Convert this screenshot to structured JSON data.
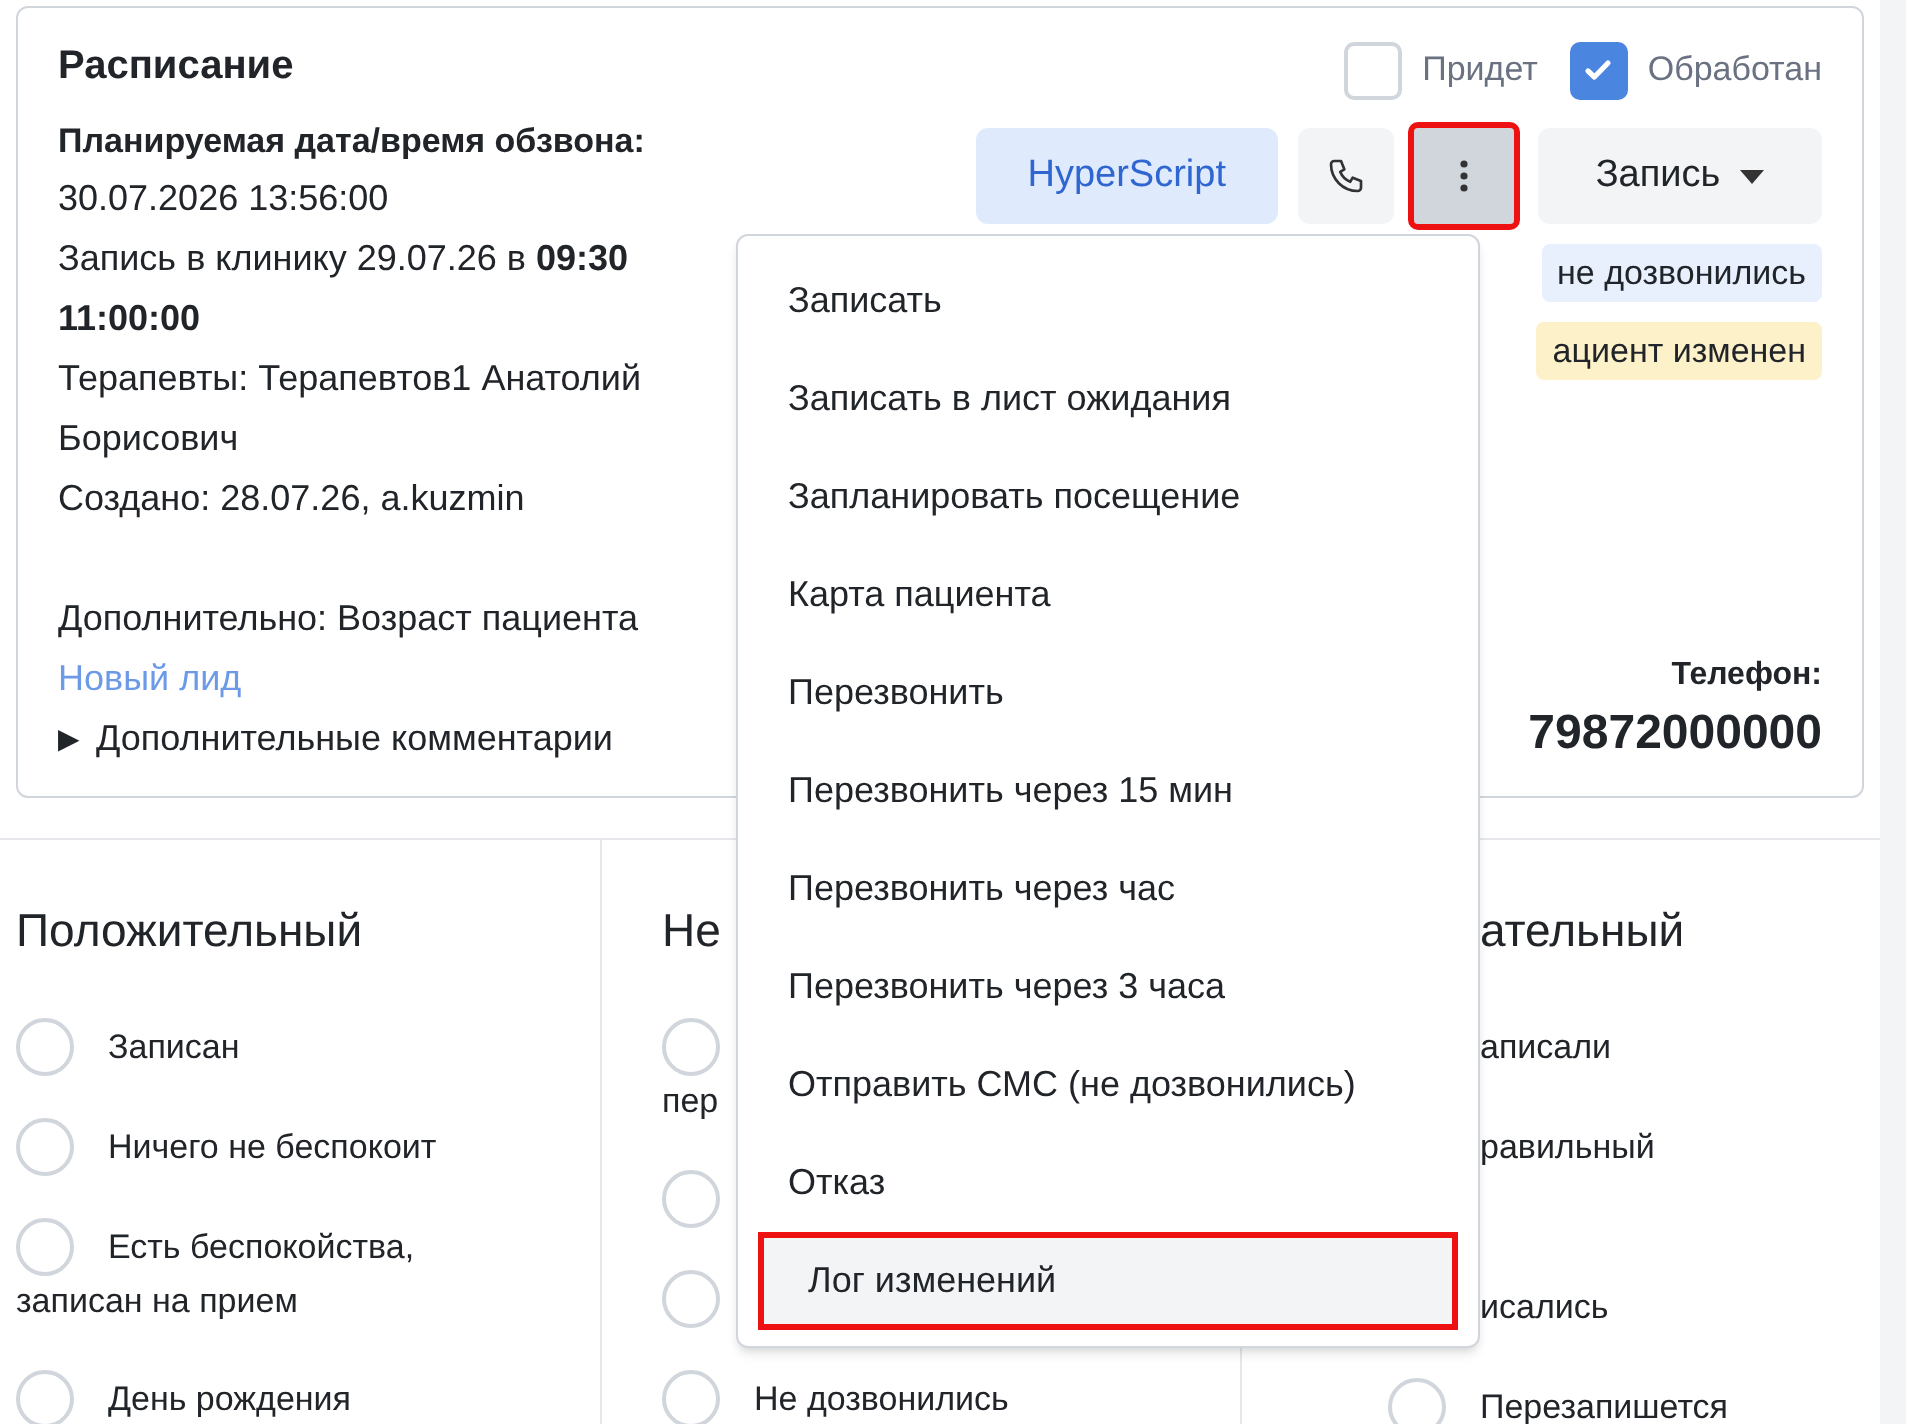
{
  "card": {
    "title": "Расписание",
    "checkboxes": [
      {
        "label": "Придет",
        "checked": false
      },
      {
        "label": "Обработан",
        "checked": true
      }
    ],
    "info": [
      {
        "kind": "label",
        "text": "Планируемая дата/время обзвона:"
      },
      {
        "kind": "line",
        "text": "30.07.2026 13:56:00"
      },
      {
        "kind": "line",
        "text": "Запись в клинику 29.07.26 в **09:30**"
      },
      {
        "kind": "line",
        "text": "**11:00:00**"
      },
      {
        "kind": "line",
        "text": "Терапевты: Терапевтов1 Анатолий"
      },
      {
        "kind": "line",
        "text": "Борисович"
      },
      {
        "kind": "line",
        "text": "Создано: 28.07.26, a.kuzmin"
      },
      {
        "kind": "gap"
      },
      {
        "kind": "line",
        "text": "Дополнительно: Возраст пациента"
      },
      {
        "kind": "link",
        "text": "Новый лид"
      },
      {
        "kind": "details",
        "text": "Дополнительные комментарии",
        "marker": "▶"
      }
    ],
    "buttons": [
      {
        "kind": "text",
        "label": "HyperScript",
        "highlighted": false
      },
      {
        "kind": "phone",
        "highlighted": false
      },
      {
        "kind": "more",
        "highlighted": true
      },
      {
        "kind": "dropdown",
        "label": "Запись",
        "highlighted": false
      }
    ],
    "badges": [
      {
        "text": "не дозвонились",
        "color": "#e8effd"
      },
      {
        "text": "ациент изменен",
        "color": "#fdf1c9"
      }
    ],
    "phone_label": "Телефон:",
    "phone": "79872000000"
  },
  "menu": [
    {
      "label": "Записать",
      "hovered": false,
      "highlighted": false
    },
    {
      "label": "Записать в лист ожидания",
      "hovered": false,
      "highlighted": false
    },
    {
      "label": "Запланировать посещение",
      "hovered": false,
      "highlighted": false
    },
    {
      "label": "Карта пациента",
      "hovered": false,
      "highlighted": false
    },
    {
      "label": "Перезвонить",
      "hovered": false,
      "highlighted": false
    },
    {
      "label": "Перезвонить через 15 мин",
      "hovered": false,
      "highlighted": false
    },
    {
      "label": "Перезвонить через час",
      "hovered": false,
      "highlighted": false
    },
    {
      "label": "Перезвонить через 3 часа",
      "hovered": false,
      "highlighted": false
    },
    {
      "label": "Отправить СМС (не дозвонились)",
      "hovered": false,
      "highlighted": false
    },
    {
      "label": "Отказ",
      "hovered": false,
      "highlighted": false
    },
    {
      "label": "Лог изменений",
      "hovered": true,
      "highlighted": true
    }
  ],
  "columns": [
    {
      "title": "Положительный",
      "items": [
        {
          "kind": "row",
          "label": "Записан",
          "selected": false
        },
        {
          "kind": "row",
          "label": "Ничего не беспокоит",
          "selected": false
        },
        {
          "kind": "row",
          "label": "Есть беспокойства,",
          "continued": "записан на прием",
          "selected": false
        },
        {
          "kind": "row",
          "label": "День рождения",
          "selected": false
        }
      ]
    },
    {
      "title": "Не",
      "items": [
        {
          "kind": "wrapped",
          "label": "пер",
          "selected": false
        },
        {
          "kind": "row",
          "selected": false
        },
        {
          "kind": "row",
          "selected": false
        },
        {
          "kind": "row",
          "label": "Не дозвонились",
          "selected": false
        }
      ]
    },
    {
      "title": "ательный",
      "items": [
        {
          "kind": "row",
          "label": "аписали"
        },
        {
          "kind": "two-line",
          "label": "равильный"
        },
        {
          "kind": "row",
          "label": "исались"
        },
        {
          "kind": "row",
          "label": "Перезапишется",
          "selected": false
        }
      ]
    }
  ]
}
